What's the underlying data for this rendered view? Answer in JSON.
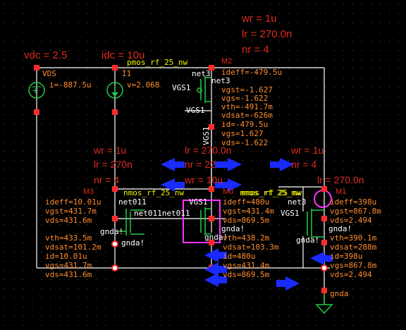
{
  "sources": {
    "vdc_label": "vdc = 2.5",
    "idc_label": "idc = 10u",
    "vds_name": "VDS",
    "vds_current": "i=-887.5u",
    "i1_name": "I1",
    "i1_voltage": "v=2.068"
  },
  "m2": {
    "params": [
      "wr = 1u",
      "lr = 270.0n",
      "nr = 4"
    ],
    "name": "M2",
    "model": "pmos_rf_25_nw",
    "net_top": "net3",
    "net_under": "net3",
    "gate_label": "VGS1",
    "gate_label2": "VGS1",
    "vert_label": "VGS1",
    "ann": [
      "ideff=-479.5u",
      "vgst=-1.627",
      "vgs=-1.622",
      "vth=-491.7m",
      "vdsat=-626m",
      "id=-479.5u",
      "vgs=1.627",
      "vds=-1.622"
    ]
  },
  "m3": {
    "params": [
      "wr = 1u",
      "lr = 270n",
      "nr = 4"
    ],
    "name": "M3",
    "model": "nmos_rf_25_nw",
    "net_a": "net011",
    "net_b": "net011net011",
    "gnd1": "gnda!",
    "gnd2": "gnda!",
    "ann": [
      "ideff=10.01u",
      "vgst=431.7m",
      "vds=431.6m",
      "vth=433.5m",
      "vdsat=101.2m",
      "id=10.01u",
      "vgs=431.7m",
      "vds=431.6m"
    ]
  },
  "m0": {
    "params": [
      "lr = 270.0n",
      "nr = 22",
      "wr = 10u"
    ],
    "name": "M0",
    "model": "nmos_rf_25_nw",
    "gate_label": "VGS1",
    "gnd1": "gnda!",
    "gnd2": "gnda!",
    "ann": [
      "ideff=480u",
      "vgst=431.4m",
      "vds=869.5m",
      "vth=438.2m",
      "vdsat=103.3m",
      "id=480u",
      "vgs=431.4m",
      "vds=869.5m"
    ]
  },
  "m1": {
    "params": [
      "wr = 1u",
      "nr = 4",
      "lr = 270.0n"
    ],
    "name": "M1",
    "model": "nmos_rf_25_nw",
    "net": "net3",
    "gate_label": "VGS1",
    "gnd1": "gnda!",
    "gnd2": "gnda!",
    "ann": [
      "ideff=398u",
      "vgst=867.8m",
      "vds=2.494",
      "vth=390.1m",
      "vdsat=288m",
      "id=398u",
      "vgs=867.8m",
      "vds=2.494"
    ]
  },
  "ground": {
    "label": "gnda"
  },
  "colors": {
    "background": "#000000",
    "wire": "#ffffff",
    "param": "#e02a1e",
    "annotation": "#ff8c2e",
    "pin": "#ff2a2a",
    "device": "#22cc44",
    "highlight": "#ff33ff",
    "arrow": "#1a2bff"
  }
}
